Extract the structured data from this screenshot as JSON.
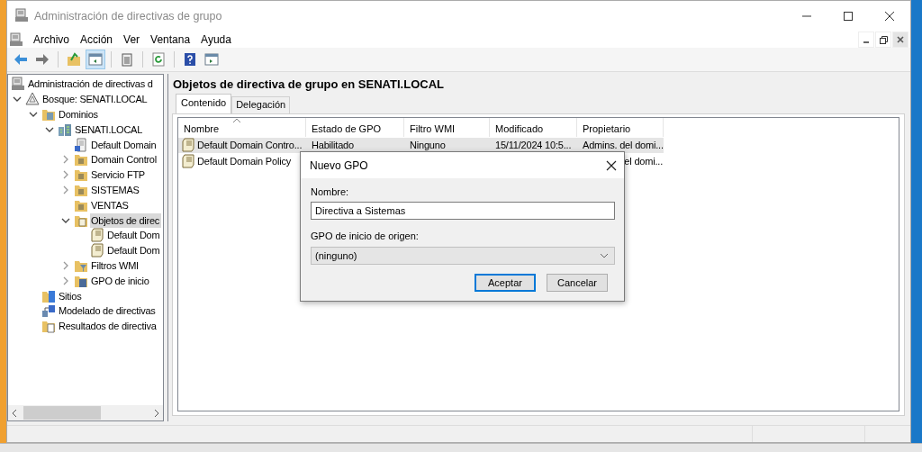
{
  "window": {
    "title": "Administración de directivas de grupo"
  },
  "menu": [
    "Archivo",
    "Acción",
    "Ver",
    "Ventana",
    "Ayuda"
  ],
  "toolbar": [
    {
      "kind": "back",
      "pressed": false
    },
    {
      "kind": "forward",
      "pressed": false
    },
    {
      "kind": "up",
      "pressed": false
    },
    {
      "kind": "tree",
      "pressed": true
    },
    {
      "kind": "copy",
      "pressed": false
    },
    {
      "kind": "refresh",
      "pressed": false
    },
    {
      "kind": "help",
      "pressed": false
    },
    {
      "kind": "pane",
      "pressed": false
    }
  ],
  "tree": [
    {
      "label": "Administración de directivas d",
      "kind": "console",
      "selected": false,
      "children": [
        {
          "label": "Bosque: SENATI.LOCAL",
          "kind": "forest",
          "expanded": true,
          "selected": false,
          "children": [
            {
              "label": "Dominios",
              "kind": "domains",
              "expanded": true,
              "selected": false,
              "children": [
                {
                  "label": "SENATI.LOCAL",
                  "kind": "domain",
                  "expanded": true,
                  "selected": false,
                  "children": [
                    {
                      "label": "Default Domain",
                      "kind": "link",
                      "selected": false
                    },
                    {
                      "label": "Domain Control",
                      "kind": "ou",
                      "expanded": false,
                      "selected": false
                    },
                    {
                      "label": "Servicio FTP",
                      "kind": "ou",
                      "expanded": false,
                      "selected": false
                    },
                    {
                      "label": "SISTEMAS",
                      "kind": "ou",
                      "expanded": false,
                      "selected": false
                    },
                    {
                      "label": "VENTAS",
                      "kind": "ou",
                      "selected": false
                    },
                    {
                      "label": "Objetos de direc",
                      "kind": "gpofolder",
                      "expanded": true,
                      "selected": true,
                      "children": [
                        {
                          "label": "Default Dom",
                          "kind": "gpo",
                          "selected": false
                        },
                        {
                          "label": "Default Dom",
                          "kind": "gpo",
                          "selected": false
                        }
                      ]
                    },
                    {
                      "label": "Filtros WMI",
                      "kind": "wmi",
                      "expanded": false,
                      "selected": false
                    },
                    {
                      "label": "GPO de inicio",
                      "kind": "starter",
                      "expanded": false,
                      "selected": false
                    }
                  ]
                }
              ]
            },
            {
              "label": "Sitios",
              "kind": "sites",
              "selected": false
            },
            {
              "label": "Modelado de directivas",
              "kind": "modeling",
              "selected": false
            },
            {
              "label": "Resultados de directiva",
              "kind": "results",
              "selected": false
            }
          ]
        }
      ]
    }
  ],
  "panel": {
    "title": "Objetos de directiva de grupo en SENATI.LOCAL",
    "tabs": [
      {
        "label": "Contenido",
        "selected": true
      },
      {
        "label": "Delegación",
        "selected": false
      }
    ],
    "table": {
      "columns": [
        "Nombre",
        "Estado de GPO",
        "Filtro WMI",
        "Modificado",
        "Propietario"
      ],
      "rows": [
        {
          "selected": true,
          "cells": [
            "Default Domain Contro...",
            "Habilitado",
            "Ninguno",
            "15/11/2024 10:5...",
            "Admins. del domi..."
          ]
        },
        {
          "selected": false,
          "cells": [
            "Default Domain Policy",
            null,
            null,
            null,
            "el domi..."
          ]
        }
      ]
    }
  },
  "dialog": {
    "title": "Nuevo GPO",
    "name_label": "Nombre:",
    "name_value": "Directiva a Sistemas",
    "source_label": "GPO de inicio de origen:",
    "source_value": "(ninguno)",
    "buttons": [
      {
        "label": "Aceptar",
        "default": true
      },
      {
        "label": "Cancelar",
        "default": false
      }
    ]
  }
}
